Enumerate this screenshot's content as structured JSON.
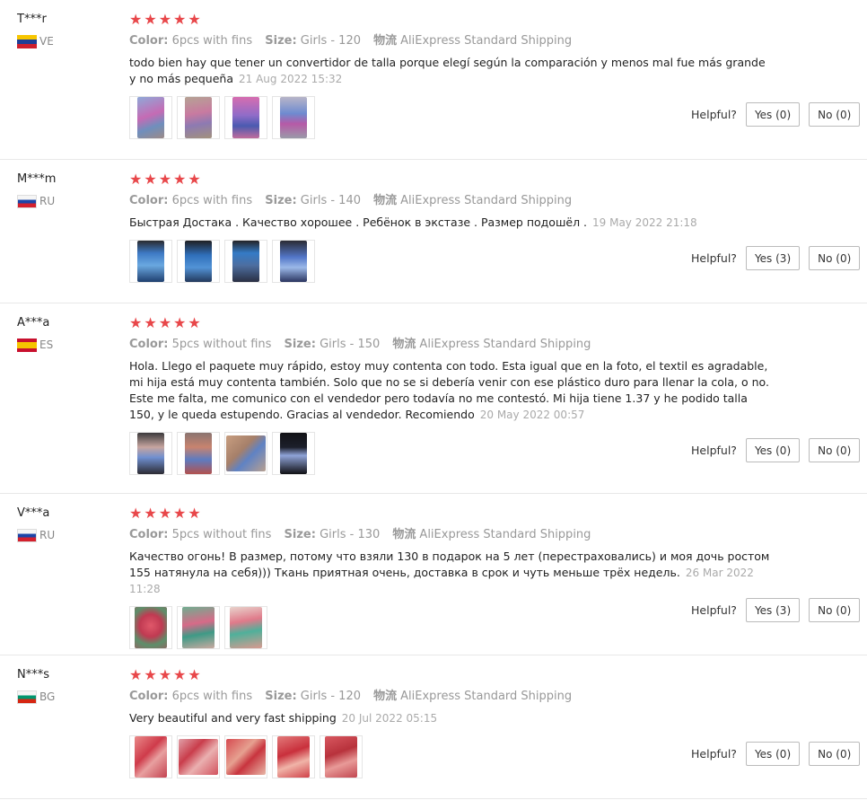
{
  "labels": {
    "color": "Color:",
    "size": "Size:",
    "shipping_cn": "物流",
    "helpful": "Helpful?"
  },
  "stars_glyph": "★★★★★",
  "reviews": [
    {
      "user": "T***r",
      "country": "VE",
      "color": "6pcs with fins",
      "size": "Girls - 120",
      "shipping": "AliExpress Standard Shipping",
      "text": "todo bien hay que tener un convertidor de talla porque elegí según la comparación y menos mal fue más grande y no más pequeña",
      "date": "21 Aug 2022 15:32",
      "yes": "Yes (0)",
      "no": "No (0)"
    },
    {
      "user": "M***m",
      "country": "RU",
      "color": "6pcs with fins",
      "size": "Girls - 140",
      "shipping": "AliExpress Standard Shipping",
      "text": "Быстрая Достака . Качество хорошее . Ребёнок в экстазе . Размер подошёл .",
      "date": "19 May 2022 21:18",
      "yes": "Yes (3)",
      "no": "No (0)"
    },
    {
      "user": "A***a",
      "country": "ES",
      "color": "5pcs without fins",
      "size": "Girls - 150",
      "shipping": "AliExpress Standard Shipping",
      "text": "Hola. Llego el paquete muy rápido, estoy muy contenta con todo. Esta igual que en la foto, el textil es agradable, mi hija está muy contenta también. Solo que no se si debería venir con ese plástico duro para llenar la cola, o no. Este me falta, me comunico con el vendedor pero todavía no me contestó. Mi hija tiene 1.37 y he podido talla 150, y le queda estupendo. Gracias al vendedor. Recomiendo",
      "date": "20 May 2022 00:57",
      "yes": "Yes (0)",
      "no": "No (0)"
    },
    {
      "user": "V***a",
      "country": "RU",
      "color": "5pcs without fins",
      "size": "Girls - 130",
      "shipping": "AliExpress Standard Shipping",
      "text": "Качество огонь! В размер, потому что взяли 130 в подарок на 5 лет (перестраховались) и моя дочь ростом 155 натянула на себя))) Ткань приятная очень, доставка в срок и чуть меньше трёх недель.",
      "date": "26 Mar 2022 11:28",
      "yes": "Yes (3)",
      "no": "No (0)"
    },
    {
      "user": "N***s",
      "country": "BG",
      "color": "6pcs with fins",
      "size": "Girls - 120",
      "shipping": "AliExpress Standard Shipping",
      "text": "Very beautiful and very fast shipping",
      "date": "20 Jul 2022 05:15",
      "yes": "Yes (0)",
      "no": "No (0)"
    }
  ]
}
